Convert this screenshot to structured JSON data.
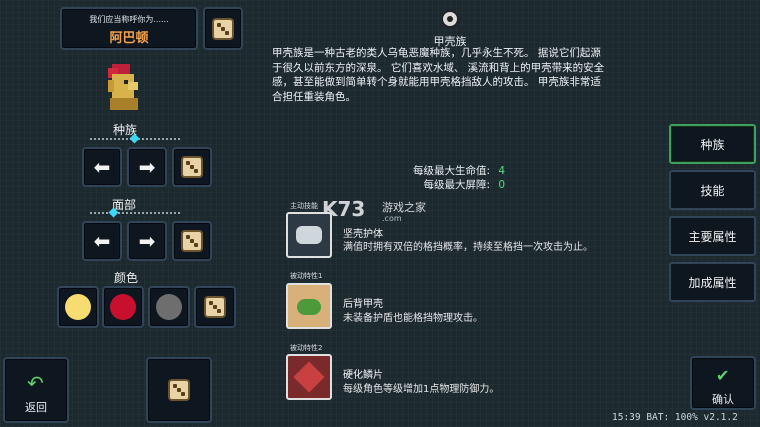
{
  "name_prompt": "我们应当称呼你为......",
  "character_name": "阿巴顿",
  "race_label": "种族",
  "face_label": "面部",
  "color_label": "颜色",
  "color_swatches": [
    "#f7dc6f",
    "#c8102e",
    "#6e6e6e"
  ],
  "back_label": "返回",
  "confirm_label": "确认",
  "race_title": "甲壳族",
  "race_description": [
    "甲壳族是一种古老的类人乌龟恶魔种族，几乎永生不死。 据说它们起源",
    "于很久以前东方的深泉。 它们喜欢水域、 溪流和背上的甲壳带来的安全",
    "感，甚至能做到简单转个身就能用甲壳格挡敌人的攻击。 甲壳族非常适",
    "合担任重装角色。"
  ],
  "stats": [
    {
      "label": "每级最大生命值:",
      "value": "4"
    },
    {
      "label": "每级最大屏障:",
      "value": "0"
    }
  ],
  "skills": [
    {
      "tag": "主动技能",
      "name": "坚壳护体",
      "desc": "满值时拥有双倍的格挡概率，持续至格挡一次攻击为止。"
    },
    {
      "tag": "被动特性1",
      "name": "后背甲壳",
      "desc": "未装备护盾也能格挡物理攻击。"
    },
    {
      "tag": "被动特性2",
      "name": "硬化鳞片",
      "desc": "每级角色等级增加1点物理防御力。"
    }
  ],
  "tabs": [
    "种族",
    "技能",
    "主要属性",
    "加成属性"
  ],
  "watermark": {
    "brand": "K73",
    "sub": "游戏之家",
    "url": ".com"
  },
  "status_bar": "15:39 BAT: 100% v2.1.2",
  "accent_color": "#3ea05a",
  "icons": [
    "dice-icon",
    "left-arrow-icon",
    "right-arrow-icon",
    "back-arrow-icon",
    "confirm-icon",
    "shell-icon"
  ]
}
